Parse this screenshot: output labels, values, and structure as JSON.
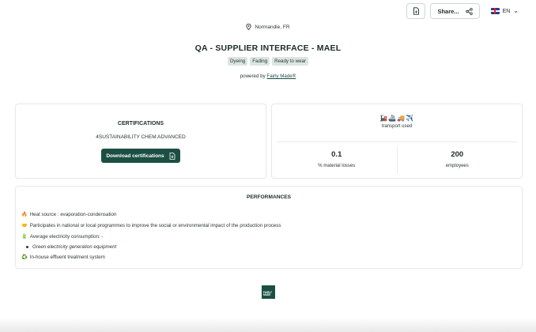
{
  "topbar": {
    "doc_icon": "document-icon",
    "share_label": "Share...",
    "share_icon": "share-icon",
    "language": "EN",
    "flag_icon": "uk-flag-icon"
  },
  "header": {
    "location": "Normandie, FR",
    "location_icon": "location-pin-icon",
    "title": "QA - SUPPLIER INTERFACE - MAEL",
    "tags": [
      "Dyeing",
      "Fading",
      "Ready to wear"
    ],
    "powered_prefix": "powered by",
    "powered_link": "Fairly Made®"
  },
  "certifications": {
    "title": "CERTIFICATIONS",
    "items": [
      "4SUSTAINABILITY CHEM ADVANCED"
    ],
    "download_label": "Download certifications",
    "download_icon": "file-download-icon"
  },
  "transport": {
    "emojis": "🚂🚢🚚✈️",
    "label": "transport used",
    "stats": [
      {
        "value": "0.1",
        "label": "% material losses"
      },
      {
        "value": "200",
        "label": "employees"
      }
    ]
  },
  "performances": {
    "title": "PERFORMANCES",
    "items": [
      {
        "icon": "🔥",
        "text": "Heat source : evaporation-condensation"
      },
      {
        "icon": "🤝",
        "text": "Participates in national or local programmes to improve the social or environmental impact of the production process"
      },
      {
        "icon": "🔋",
        "text": "Average electricity consumption: -"
      },
      {
        "sub": "Green electricity generation equipment"
      },
      {
        "icon": "♻️",
        "text": "In-house effluent treatment system"
      }
    ]
  },
  "footer": {
    "logo_text": "FAIRLY MADE"
  },
  "colors": {
    "brand": "#1c4f43",
    "tag_bg": "#dbe6e1"
  }
}
